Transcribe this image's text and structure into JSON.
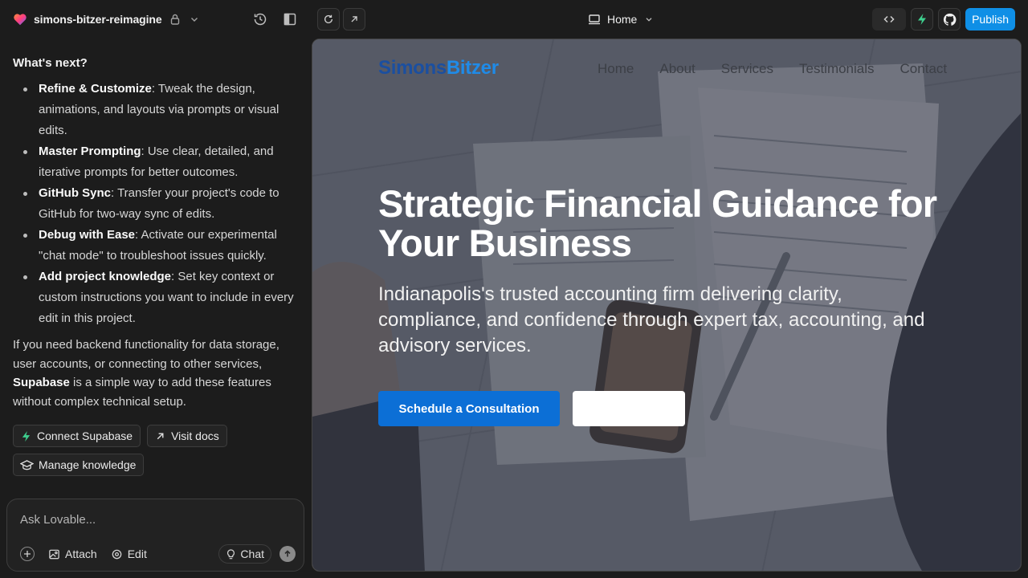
{
  "topbar": {
    "project_name": "simons-bitzer-reimagine",
    "route_label": "Home",
    "publish_label": "Publish"
  },
  "chat": {
    "heading": "What's next?",
    "bullets": [
      {
        "title": "Refine & Customize",
        "text": ": Tweak the design, animations, and layouts via prompts or visual edits."
      },
      {
        "title": "Master Prompting",
        "text": ": Use clear, detailed, and iterative prompts for better outcomes."
      },
      {
        "title": "GitHub Sync",
        "text": ": Transfer your project's code to GitHub for two-way sync of edits."
      },
      {
        "title": "Debug with Ease",
        "text": ": Activate our experimental \"chat mode\" to troubleshoot issues quickly."
      },
      {
        "title": "Add project knowledge",
        "text": ": Set key context or custom instructions you want to include in every edit in this project."
      }
    ],
    "para_before": "If you need backend functionality for data storage, user accounts, or connecting to other services, ",
    "para_bold": "Supabase",
    "para_after": " is a simple way to add these features without complex technical setup.",
    "chips": {
      "connect_supabase": "Connect Supabase",
      "visit_docs": "Visit docs",
      "manage_knowledge": "Manage knowledge"
    },
    "composer": {
      "placeholder": "Ask Lovable...",
      "attach": "Attach",
      "edit": "Edit",
      "chat": "Chat"
    }
  },
  "preview": {
    "logo_part1": "Simons",
    "logo_part2": "Bitzer",
    "nav": [
      "Home",
      "About",
      "Services",
      "Testimonials",
      "Contact"
    ],
    "hero_title": "Strategic Financial Guidance for Your Business",
    "hero_subtitle": "Indianapolis's trusted accounting firm delivering clarity, compliance, and confidence through expert tax, accounting, and advisory services.",
    "cta_primary": "Schedule a Consultation"
  },
  "colors": {
    "accent_blue": "#0f8fe6",
    "supabase_green": "#3ecf8e",
    "logo_dark_blue": "#1b4fa0",
    "logo_light_blue": "#1f8be8"
  }
}
